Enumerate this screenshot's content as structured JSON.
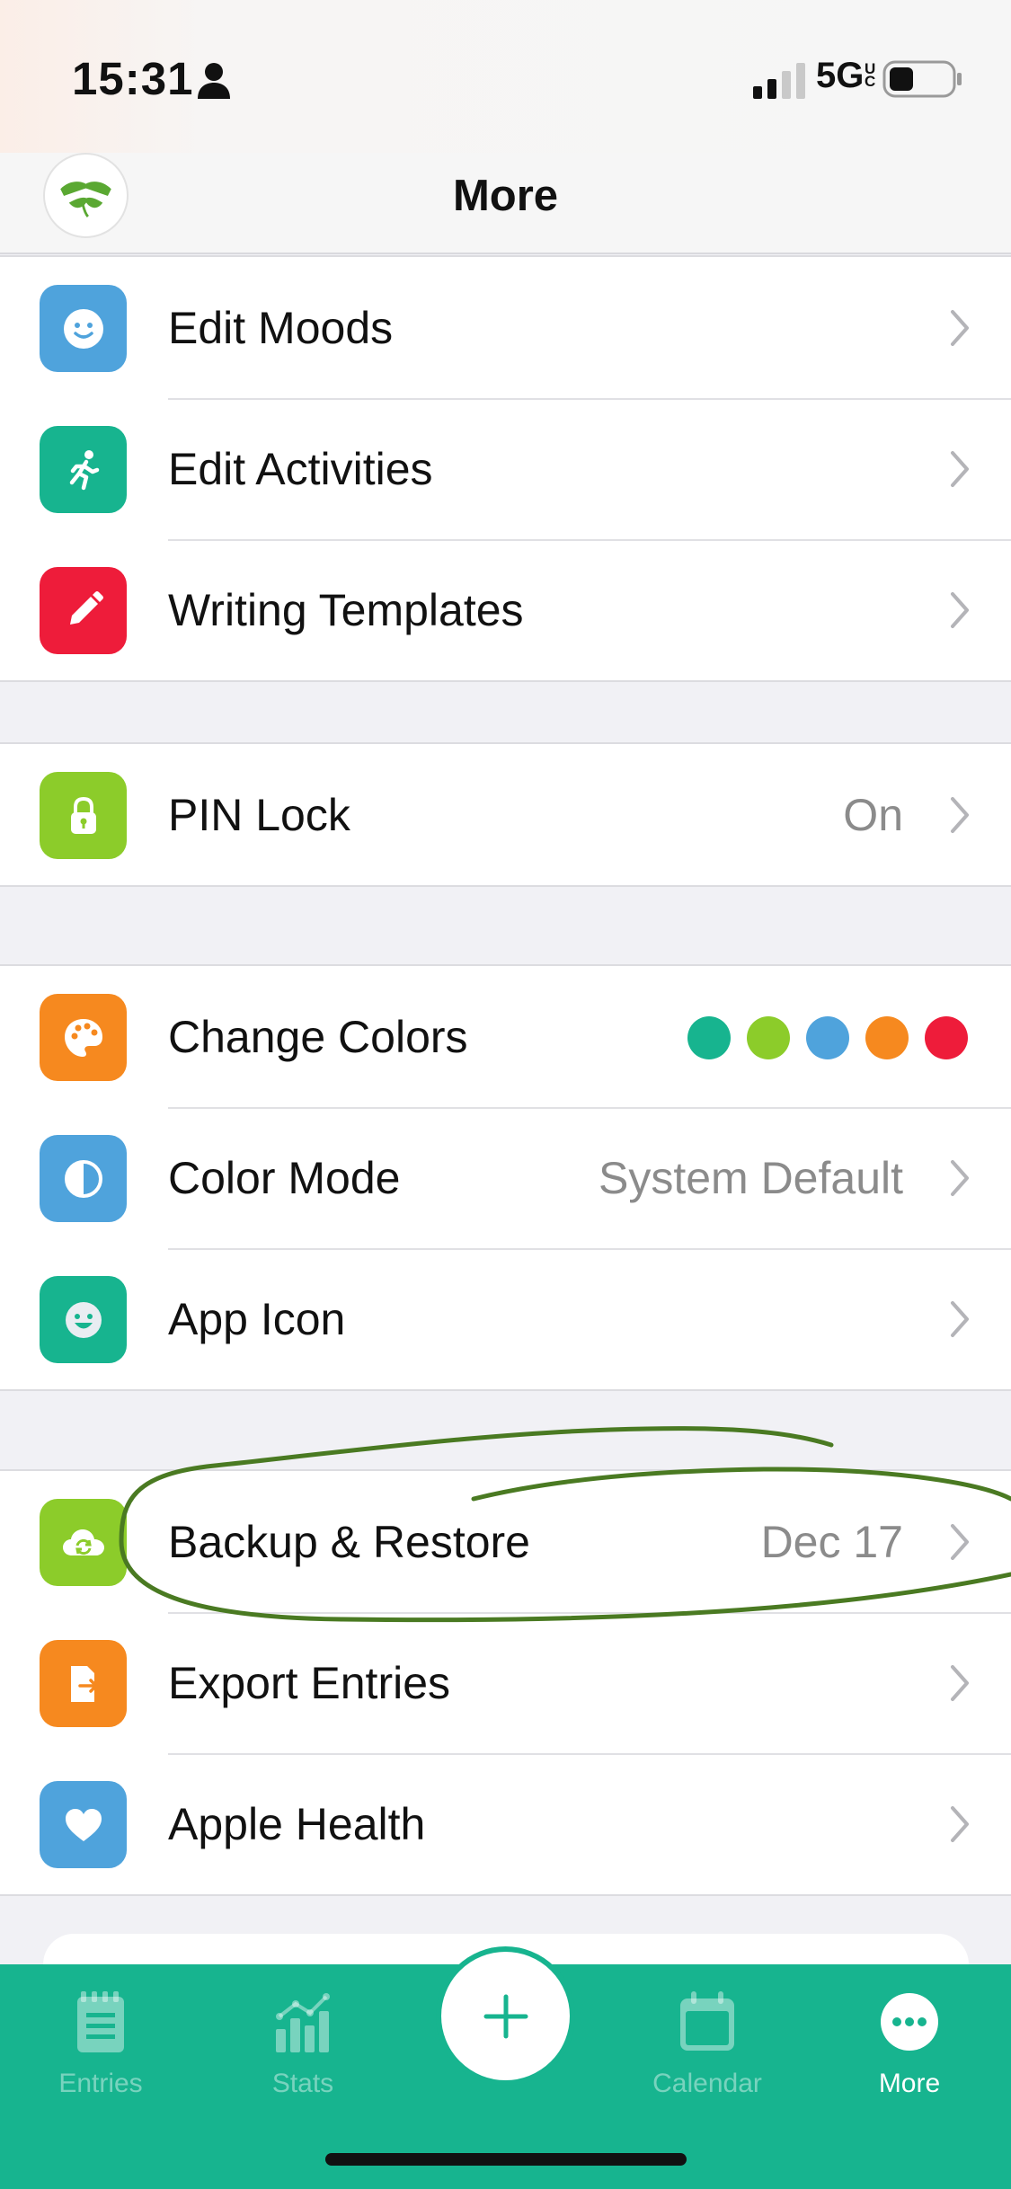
{
  "status_bar": {
    "time": "15:31",
    "network": "5G",
    "network_suffix": "UC",
    "icons": [
      "person-icon",
      "signal-icon",
      "battery-icon"
    ]
  },
  "header": {
    "title": "More",
    "logo": "hands-leaf-logo"
  },
  "groups": [
    {
      "items": [
        {
          "label": "Edit Moods",
          "icon": "smiley-icon",
          "color": "#4fa3dc"
        },
        {
          "label": "Edit Activities",
          "icon": "runner-icon",
          "color": "#17b48f"
        },
        {
          "label": "Writing Templates",
          "icon": "pencil-icon",
          "color": "#ee1c3a"
        }
      ]
    },
    {
      "items": [
        {
          "label": "PIN Lock",
          "value": "On",
          "icon": "lock-icon",
          "color": "#8ccc2a"
        }
      ]
    },
    {
      "items": [
        {
          "label": "Change Colors",
          "icon": "palette-icon",
          "color": "#f6891f",
          "swatches": [
            "#17b48f",
            "#8ccc2a",
            "#4fa3dc",
            "#f6891f",
            "#ee1c3a"
          ]
        },
        {
          "label": "Color Mode",
          "value": "System Default",
          "icon": "contrast-icon",
          "color": "#4fa3dc"
        },
        {
          "label": "App Icon",
          "icon": "happy-face-icon",
          "color": "#17b48f"
        }
      ]
    },
    {
      "items": [
        {
          "label": "Backup & Restore",
          "value": "Dec 17",
          "icon": "cloud-sync-icon",
          "color": "#8ccc2a"
        },
        {
          "label": "Export Entries",
          "icon": "export-file-icon",
          "color": "#f6891f"
        },
        {
          "label": "Apple Health",
          "icon": "heart-icon",
          "color": "#4fa3dc"
        }
      ]
    }
  ],
  "tab_bar": {
    "tabs": [
      {
        "label": "Entries",
        "icon": "entries-icon",
        "active": false
      },
      {
        "label": "Stats",
        "icon": "stats-icon",
        "active": false
      },
      {
        "label": "Calendar",
        "icon": "calendar-icon",
        "active": false
      },
      {
        "label": "More",
        "icon": "more-icon",
        "active": true
      }
    ],
    "add_icon": "plus-icon",
    "background": "#17b48f"
  },
  "annotation": {
    "color": "#4a7a22",
    "shape": "hand-drawn ellipse around Backup & Restore"
  }
}
